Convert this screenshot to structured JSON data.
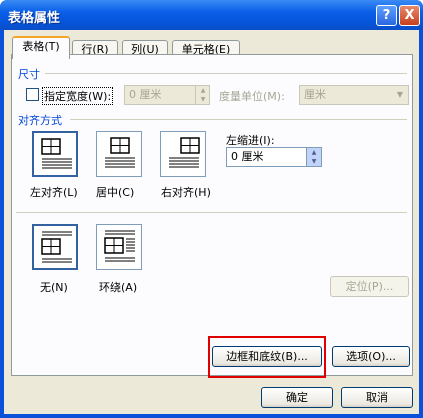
{
  "window": {
    "title": "表格属性"
  },
  "titlebar_buttons": {
    "help": "?",
    "close": "X"
  },
  "tabs": [
    {
      "label": "表格(T)",
      "active": true
    },
    {
      "label": "行(R)",
      "active": false
    },
    {
      "label": "列(U)",
      "active": false
    },
    {
      "label": "单元格(E)",
      "active": false
    }
  ],
  "size": {
    "section": "尺寸",
    "specify_width_label": "指定宽度(W):",
    "width_value": "0 厘米",
    "unit_label": "度量单位(M):",
    "unit_value": "厘米"
  },
  "alignment": {
    "section": "对齐方式",
    "options": [
      {
        "label": "左对齐(L)",
        "selected": true
      },
      {
        "label": "居中(C)",
        "selected": false
      },
      {
        "label": "右对齐(H)",
        "selected": false
      }
    ],
    "indent_label": "左缩进(I):",
    "indent_value": "0 厘米"
  },
  "wrapping": {
    "options": [
      {
        "label": "无(N)",
        "selected": true
      },
      {
        "label": "环绕(A)",
        "selected": false
      }
    ],
    "position_button": "定位(P)..."
  },
  "buttons": {
    "borders": "边框和底纹(B)...",
    "options": "选项(O)...",
    "ok": "确定",
    "cancel": "取消"
  },
  "colors": {
    "titlebar": "#0a5fe8",
    "client": "#ece9d8",
    "section": "#0046d5",
    "highlight": "#e00000"
  }
}
